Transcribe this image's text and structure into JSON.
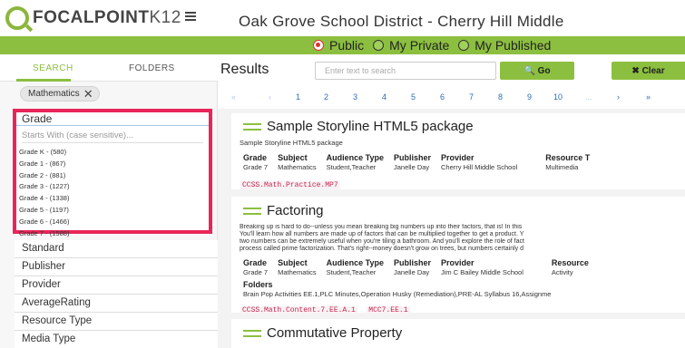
{
  "header": {
    "logo_main": "FOCALPOINT",
    "logo_suffix": "K12",
    "district_title": "Oak Grove School District - Cherry Hill Middle"
  },
  "visibility": {
    "options": [
      {
        "label": "Public",
        "selected": true
      },
      {
        "label": "My Private",
        "selected": false
      },
      {
        "label": "My Published",
        "selected": false
      }
    ]
  },
  "sidebar": {
    "tabs": [
      {
        "label": "SEARCH",
        "active": true
      },
      {
        "label": "FOLDERS",
        "active": false
      }
    ],
    "active_filter": "Mathematics",
    "grade_facet": {
      "title": "Grade",
      "search_placeholder": "Starts With (case sensitive)...",
      "items": [
        "Grade K - (580)",
        "Grade 1 - (867)",
        "Grade 2 - (881)",
        "Grade 3 - (1227)",
        "Grade 4 - (1338)",
        "Grade 5 - (1197)",
        "Grade 6 - (1466)",
        "Grade 7 - (1588)"
      ]
    },
    "facets": [
      "Standard",
      "Publisher",
      "Provider",
      "AverageRating",
      "Resource Type",
      "Media Type"
    ]
  },
  "main": {
    "results_title": "Results",
    "search_placeholder": "Enter text to search",
    "go_label": "Go",
    "clear_label": "Clear",
    "pagination": [
      "«",
      "‹",
      "1",
      "2",
      "3",
      "4",
      "5",
      "6",
      "7",
      "8",
      "9",
      "10",
      "...",
      "›",
      "»"
    ],
    "results": [
      {
        "title": "Sample Storyline HTML5 package",
        "subtitle": "Sample Storyline HTML5 package",
        "meta": [
          {
            "h": "Grade",
            "v": "Grade 7"
          },
          {
            "h": "Subject",
            "v": "Mathematics"
          },
          {
            "h": "Audience Type",
            "v": "Student,Teacher"
          },
          {
            "h": "Publisher",
            "v": "Janelle Day"
          },
          {
            "h": "Provider",
            "v": "Cherry Hill Middle School"
          },
          {
            "h": "Resource T",
            "v": "Multimedia"
          }
        ],
        "standards": [
          "CCSS.Math.Practice.MP7"
        ]
      },
      {
        "title": "Factoring",
        "description": [
          "Breaking up is hard to do--unless you mean breaking big numbers up into their factors, that is! In this",
          "You'll learn how all numbers are made up of factors that can be multiplied together to get a product. Y",
          "two numbers can be extremely useful when you're tiling a bathroom. And you'll explore the role of fact",
          "process called prime factorization. That's right--money doesn't grow on trees, but numbers certainly d"
        ],
        "meta": [
          {
            "h": "Grade",
            "v": "Grade 7"
          },
          {
            "h": "Subject",
            "v": "Mathematics"
          },
          {
            "h": "Audience Type",
            "v": "Student,Teacher"
          },
          {
            "h": "Publisher",
            "v": "Janelle Day"
          },
          {
            "h": "Provider",
            "v": "Jim C Bailey Middle School"
          },
          {
            "h": "Resource",
            "v": "Activity"
          }
        ],
        "folders_label": "Folders",
        "folders": "Brain Pop Activities EE.1,PLC Minutes,Operation Husky (Remediation),PRE-AL Syllabus 16,Assignme",
        "standards": [
          "CCSS.Math.Content.7.EE.A.1",
          "MCC7.EE.1"
        ]
      },
      {
        "title": "Commutative Property"
      }
    ]
  },
  "colors": {
    "brand_green": "#8cbf3f",
    "highlight_pink": "#e8255a",
    "link_blue": "#2a6ebb",
    "standard_red": "#c7254e"
  }
}
